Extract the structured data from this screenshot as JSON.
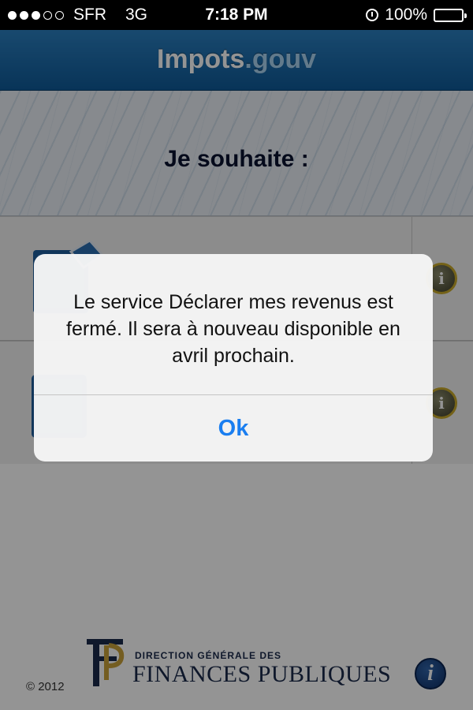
{
  "status_bar": {
    "signal_bars_on": 3,
    "signal_bars_total": 5,
    "carrier": "SFR",
    "network": "3G",
    "time": "7:18 PM",
    "battery": "100%",
    "icons": [
      "signal-icon",
      "alarm-icon",
      "battery-icon"
    ]
  },
  "nav": {
    "title_main": "Impots",
    "title_suffix": ".gouv"
  },
  "header": {
    "title": "Je souhaite :"
  },
  "menu": {
    "rows": [
      {
        "icon": "declaration-icon",
        "info_icon": "info-icon",
        "info_glyph": "i"
      },
      {
        "icon": "document-icon",
        "info_icon": "info-icon",
        "info_glyph": "i"
      }
    ]
  },
  "footer": {
    "copyright": "© 2012",
    "dgfip_line1": "DIRECTION GÉNÉRALE DES",
    "dgfip_line2": "FINANCES PUBLIQUES",
    "info_glyph": "i"
  },
  "alert": {
    "message": "Le service Déclarer mes revenus est fermé. Il sera à nouveau disponible en avril prochain.",
    "ok_label": "Ok"
  },
  "colors": {
    "nav_blue": "#1b6aab",
    "alert_button_blue": "#1a7ef0",
    "info_badge_gold": "#c9a92a",
    "dgfip_navy": "#1a2a4a"
  }
}
